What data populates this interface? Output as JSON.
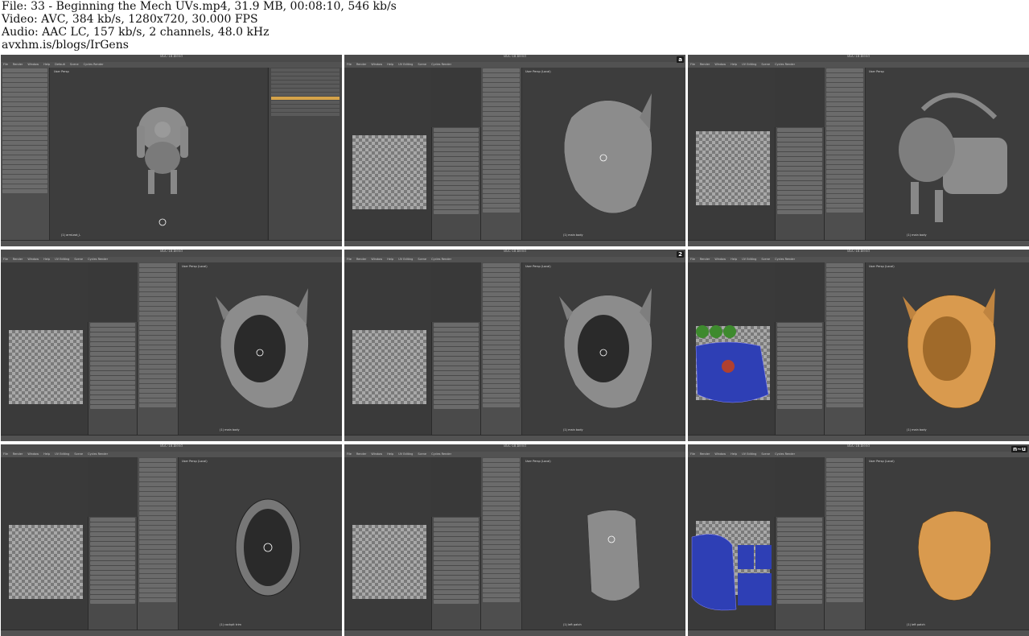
{
  "header": {
    "file": "File: 33 - Beginning the Mech UVs.mp4, 31.9 MB, 00:08:10, 546 kb/s",
    "video": "Video: AVC, 384 kb/s, 1280x720, 30.000 FPS",
    "audio": "Audio: AAC LC, 157 kb/s, 2 channels, 48.0 kHz",
    "site": "avxhm.is/blogs/IrGens"
  },
  "frames": [
    {
      "title": "BGC-18.blend",
      "viewport_label": "User Persp",
      "badge": "",
      "footer": "(1) armLeat_L",
      "menu": [
        "File",
        "Render",
        "Window",
        "Help",
        "Default",
        "Scene",
        "Cycles Render"
      ]
    },
    {
      "title": "BGC-18.blend",
      "viewport_label": "User Persp (Local)",
      "badge": "a",
      "footer": "(1) main body",
      "menu": [
        "File",
        "Render",
        "Window",
        "Help",
        "UV Editing",
        "Scene",
        "Cycles Render"
      ]
    },
    {
      "title": "BGC-18.blend",
      "viewport_label": "User Persp",
      "badge": "",
      "footer": "(1) main body",
      "menu": [
        "File",
        "Render",
        "Window",
        "Help",
        "UV Editing",
        "Scene",
        "Cycles Render"
      ]
    },
    {
      "title": "BGC-18.blend",
      "viewport_label": "User Persp (Local)",
      "badge": "",
      "footer": "(1) main body",
      "menu": [
        "File",
        "Render",
        "Window",
        "Help",
        "UV Editing",
        "Scene",
        "Cycles Render"
      ]
    },
    {
      "title": "BGC-18.blend",
      "viewport_label": "User Persp (Local)",
      "badge": "2",
      "footer": "(1) main body",
      "menu": [
        "File",
        "Render",
        "Window",
        "Help",
        "UV Editing",
        "Scene",
        "Cycles Render"
      ]
    },
    {
      "title": "BGC-18.blend",
      "viewport_label": "User Persp (Local)",
      "badge": "",
      "footer": "(1) main body",
      "menu": [
        "File",
        "Render",
        "Window",
        "Help",
        "UV Editing",
        "Scene",
        "Cycles Render"
      ]
    },
    {
      "title": "BGC-18.blend",
      "viewport_label": "User Persp (Local)",
      "badge": "",
      "footer": "(1) cockpit trim",
      "menu": [
        "File",
        "Render",
        "Window",
        "Help",
        "UV Editing",
        "Scene",
        "Cycles Render"
      ]
    },
    {
      "title": "BGC-18.blend",
      "viewport_label": "User Persp (Local)",
      "badge": "",
      "footer": "(1) left patch",
      "menu": [
        "File",
        "Render",
        "Window",
        "Help",
        "UV Editing",
        "Scene",
        "Cycles Render"
      ]
    },
    {
      "title": "BGC-18.blend",
      "viewport_label": "User Persp (Local)",
      "badge": "n~u",
      "footer": "(1) left patch",
      "menu": [
        "File",
        "Render",
        "Window",
        "Help",
        "UV Editing",
        "Scene",
        "Cycles Render"
      ]
    }
  ],
  "colors": {
    "blender_bg": "#393939",
    "orange_select": "#d99a4e",
    "uv_blue": "#2e3fb5"
  }
}
